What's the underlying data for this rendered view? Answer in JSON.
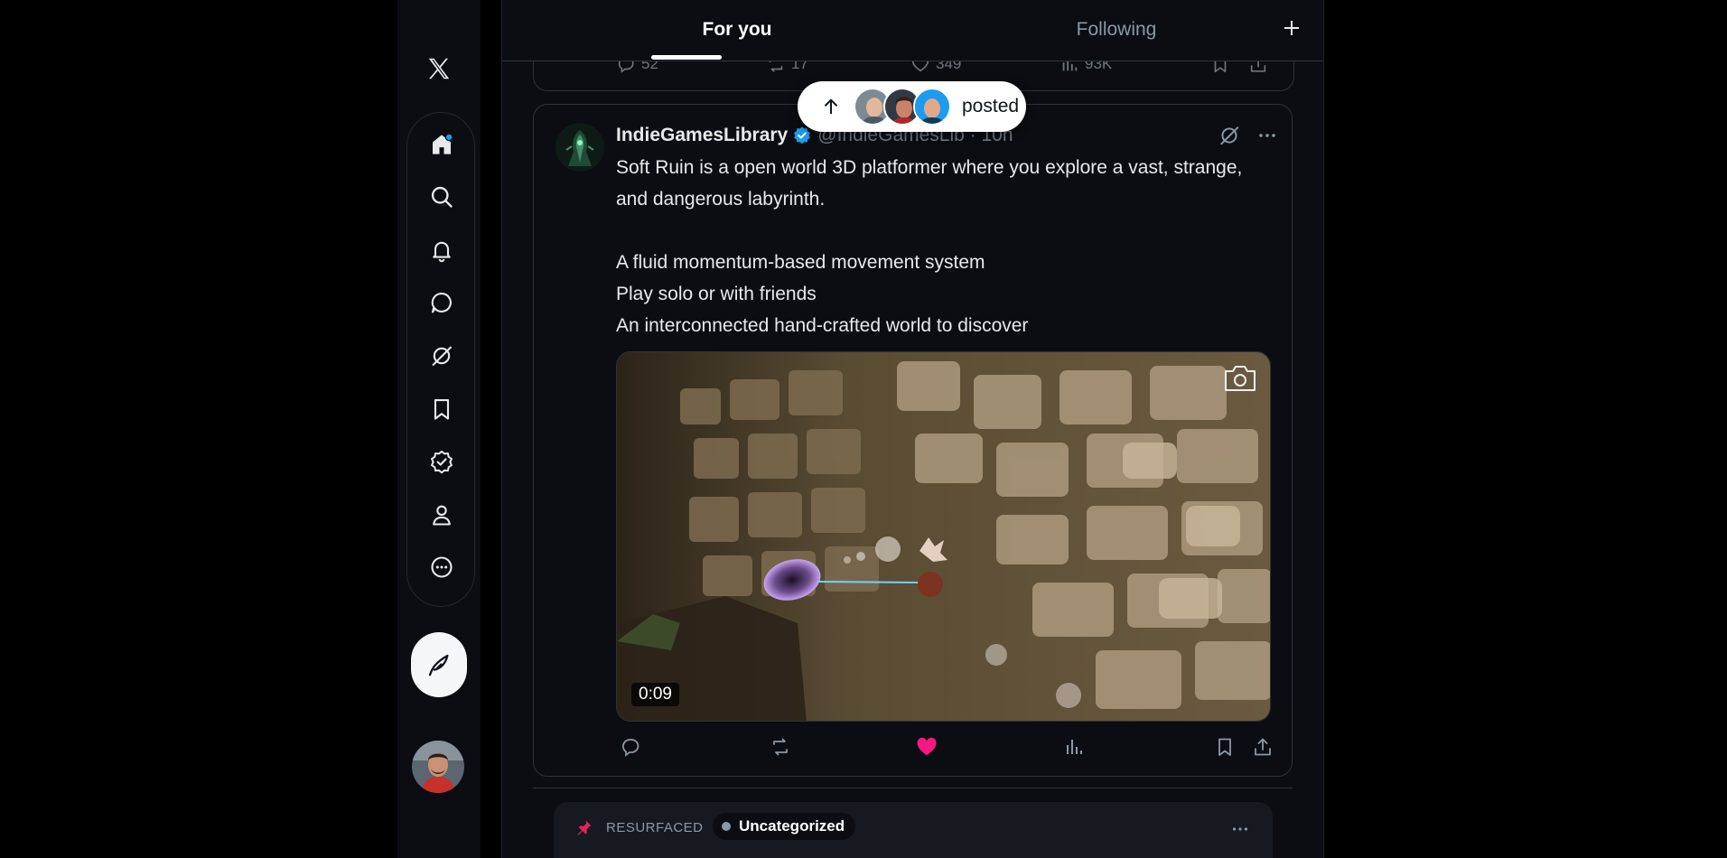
{
  "nav": {
    "logo_icon": "x-logo-icon",
    "items": [
      {
        "icon": "home-icon",
        "has_notification_dot": true
      },
      {
        "icon": "search-icon"
      },
      {
        "icon": "bell-icon"
      },
      {
        "icon": "message-icon"
      },
      {
        "icon": "grok-icon"
      },
      {
        "icon": "bookmark-icon"
      },
      {
        "icon": "verified-badge-icon"
      },
      {
        "icon": "profile-icon"
      },
      {
        "icon": "more-circle-icon"
      }
    ],
    "compose_icon": "feather-icon"
  },
  "tabs": {
    "for_you": "For you",
    "following": "Following",
    "active": "for_you"
  },
  "prev_post": {
    "replies": "52",
    "reposts": "17",
    "likes": "349",
    "views": "93K"
  },
  "new_posts_pill": {
    "label": "posted",
    "avatar_count": 3
  },
  "post": {
    "author_name": "IndieGamesLibrary",
    "author_meta": "@IndieGamesLib · 10h",
    "verified": true,
    "text_line1": "Soft Ruin is a open world 3D platformer where you explore a vast, strange,",
    "text_line2": "and dangerous labyrinth.",
    "text_line3": "A fluid momentum-based movement system",
    "text_line4": "Play solo or with friends",
    "text_line5": "An interconnected hand-crafted world to discover",
    "video_duration": "0:09",
    "liked": true,
    "like_color": "#f91880",
    "accent_color": "#1d9bf0"
  },
  "resurfaced": {
    "label": "RESURFACED",
    "category": "Uncategorized"
  }
}
